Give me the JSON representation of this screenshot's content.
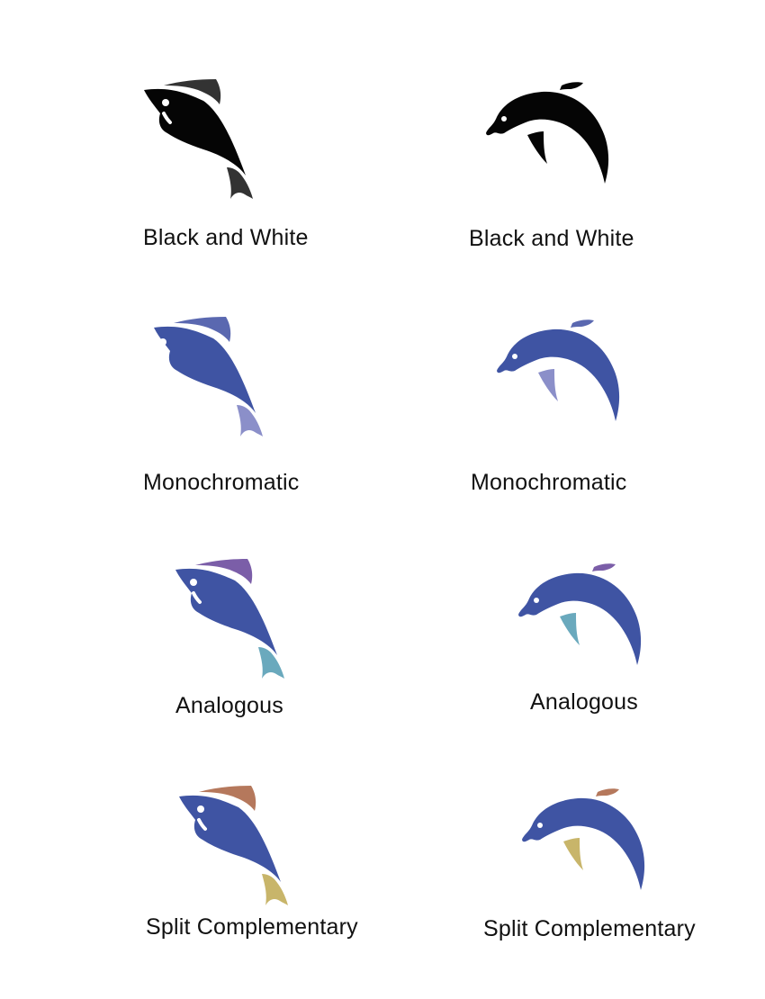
{
  "palette": {
    "black": "#050505",
    "dark_fin": "#333333",
    "blue": "#3f54a3",
    "periwinkle_fin": "#5a68b0",
    "lavender": "#8b8fc9",
    "purple": "#7b5ea8",
    "teal": "#6aa9bd",
    "brown": "#b5785c",
    "khaki": "#c8b56a",
    "eye": "#ffffff"
  },
  "labels": {
    "fish_bw": "Black and White",
    "dolphin_bw": "Black and White",
    "fish_mono": "Monochromatic",
    "dolphin_mono": "Monochromatic",
    "fish_analog": "Analogous",
    "dolphin_analog": "Analogous",
    "fish_split": "Split Complementary",
    "dolphin_split": "Split Complementary"
  },
  "swatches": {
    "fish_bw": {
      "body": "black",
      "top": "dark_fin",
      "tail": "dark_fin"
    },
    "dolphin_bw": {
      "body": "black",
      "top": "black",
      "flipper": "black"
    },
    "fish_mono": {
      "body": "blue",
      "top": "periwinkle_fin",
      "tail": "lavender"
    },
    "dolphin_mono": {
      "body": "blue",
      "top": "periwinkle_fin",
      "flipper": "lavender"
    },
    "fish_analog": {
      "body": "blue",
      "top": "purple",
      "tail": "teal"
    },
    "dolphin_analog": {
      "body": "blue",
      "top": "purple",
      "flipper": "teal"
    },
    "fish_split": {
      "body": "blue",
      "top": "brown",
      "tail": "khaki"
    },
    "dolphin_split": {
      "body": "blue",
      "top": "brown",
      "flipper": "khaki"
    }
  }
}
